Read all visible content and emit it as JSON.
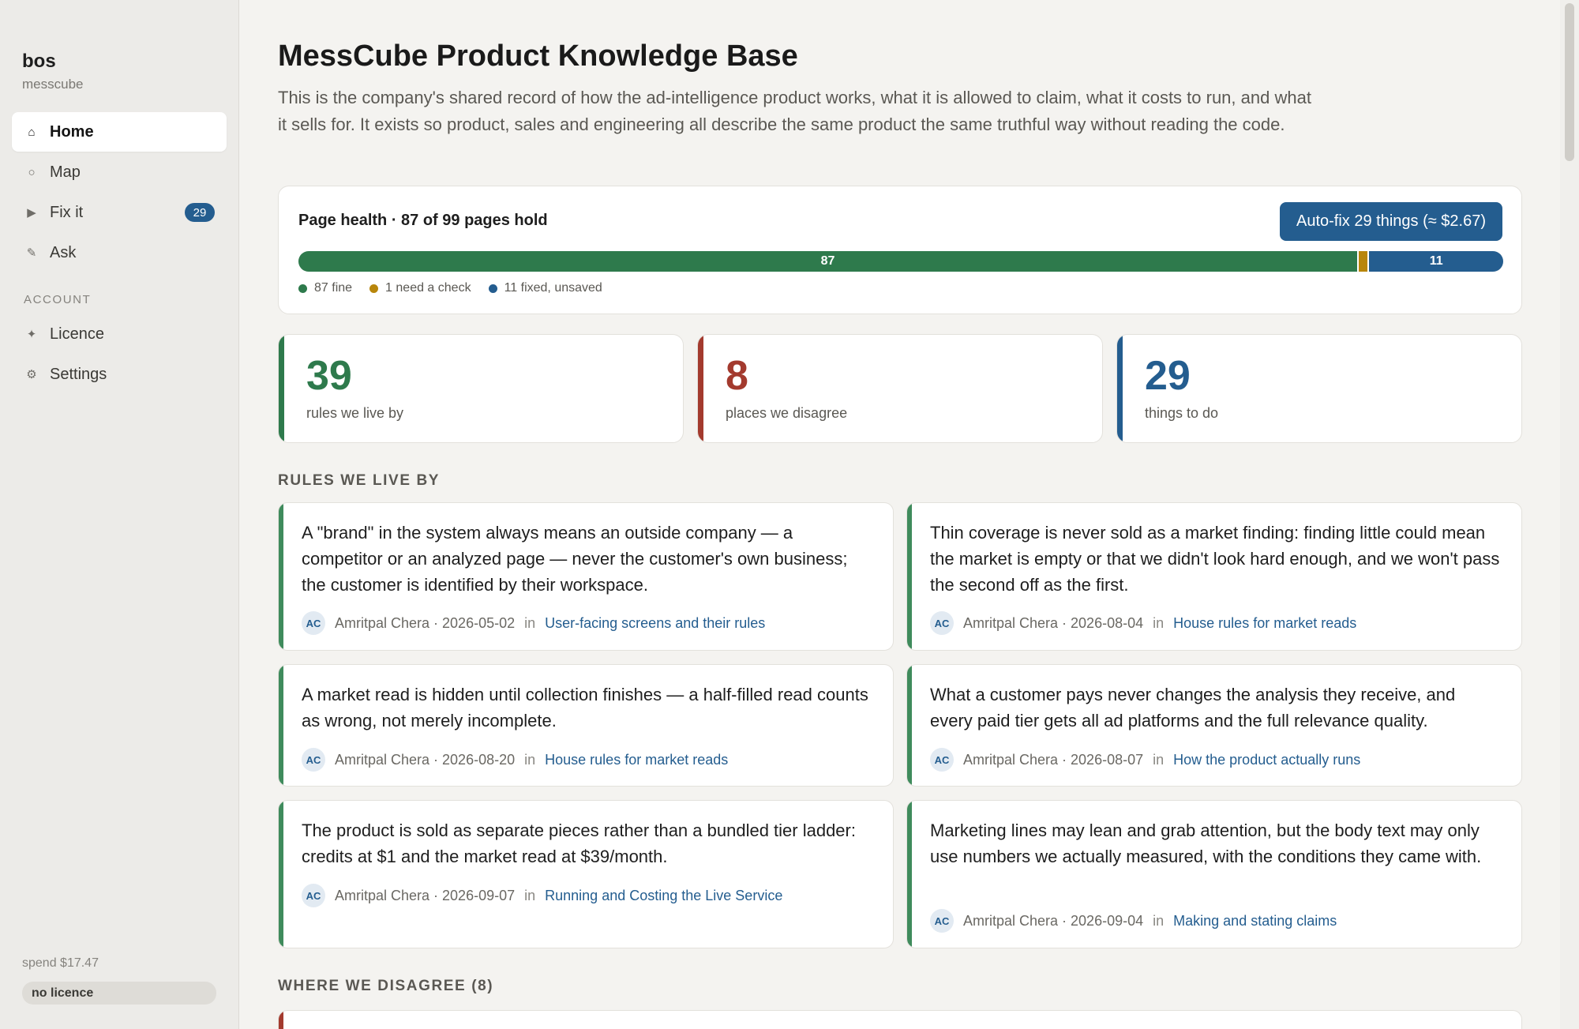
{
  "sidebar": {
    "brand": "bos",
    "workspace": "messcube",
    "nav": [
      {
        "label": "Home",
        "icon": "home-icon",
        "glyph": "⌂",
        "active": true
      },
      {
        "label": "Map",
        "icon": "map-icon",
        "glyph": "○"
      },
      {
        "label": "Fix it",
        "icon": "play-icon",
        "glyph": "▶",
        "badge": "29"
      },
      {
        "label": "Ask",
        "icon": "pencil-icon",
        "glyph": "✎"
      }
    ],
    "account_heading": "ACCOUNT",
    "account_nav": [
      {
        "label": "Licence",
        "icon": "sparkle-icon",
        "glyph": "✦"
      },
      {
        "label": "Settings",
        "icon": "gear-icon",
        "glyph": "⚙"
      }
    ],
    "spend": "spend $17.47",
    "licence_status": "no licence"
  },
  "main": {
    "title": "MessCube Product Knowledge Base",
    "intro": "This is the company's shared record of how the ad-intelligence product works, what it is allowed to claim, what it costs to run, and what it sells for. It exists so product, sales and engineering all describe the same product the same truthful way without reading the code.",
    "health": {
      "title": "Page health · 87 of 99 pages hold",
      "autofix_label": "Auto-fix 29 things (≈ $2.67)",
      "total": 99,
      "segments": [
        {
          "key": "fine",
          "count": 87,
          "label": "87",
          "legend": "87 fine",
          "color": "#2e7a4c"
        },
        {
          "key": "check",
          "count": 1,
          "label": "",
          "legend": "1 need a check",
          "color": "#b8860b"
        },
        {
          "key": "fixed",
          "count": 11,
          "label": "11",
          "legend": "11 fixed, unsaved",
          "color": "#245d8f"
        }
      ]
    },
    "stats": [
      {
        "value": "39",
        "label": "rules we live by",
        "color": "#2e7a4c"
      },
      {
        "value": "8",
        "label": "places we disagree",
        "color": "#a33a2e"
      },
      {
        "value": "29",
        "label": "things to do",
        "color": "#245d8f"
      }
    ],
    "rules_heading": "RULES WE LIVE BY",
    "rules": [
      {
        "text": "A \"brand\" in the system always means an outside company — a competitor or an analyzed page — never the customer's own business; the customer is identified by their workspace.",
        "initials": "AC",
        "author_date": "Amritpal Chera · 2026-05-02",
        "in": "in",
        "page": "User-facing screens and their rules"
      },
      {
        "text": "Thin coverage is never sold as a market finding: finding little could mean the market is empty or that we didn't look hard enough, and we won't pass the second off as the first.",
        "initials": "AC",
        "author_date": "Amritpal Chera · 2026-08-04",
        "in": "in",
        "page": "House rules for market reads"
      },
      {
        "text": "A market read is hidden until collection finishes — a half-filled read counts as wrong, not merely incomplete.",
        "initials": "AC",
        "author_date": "Amritpal Chera · 2026-08-20",
        "in": "in",
        "page": "House rules for market reads"
      },
      {
        "text": "What a customer pays never changes the analysis they receive, and every paid tier gets all ad platforms and the full relevance quality.",
        "initials": "AC",
        "author_date": "Amritpal Chera · 2026-08-07",
        "in": "in",
        "page": "How the product actually runs"
      },
      {
        "text": "The product is sold as separate pieces rather than a bundled tier ladder: credits at $1 and the market read at $39/month.",
        "initials": "AC",
        "author_date": "Amritpal Chera · 2026-09-07",
        "in": "in",
        "page": "Running and Costing the Live Service"
      },
      {
        "text": "Marketing lines may lean and grab attention, but the body text may only use numbers we actually measured, with the conditions they came with.",
        "initials": "AC",
        "author_date": "Amritpal Chera · 2026-09-04",
        "in": "in",
        "page": "Making and stating claims"
      }
    ],
    "disagree_heading": "WHERE WE DISAGREE (8)"
  }
}
